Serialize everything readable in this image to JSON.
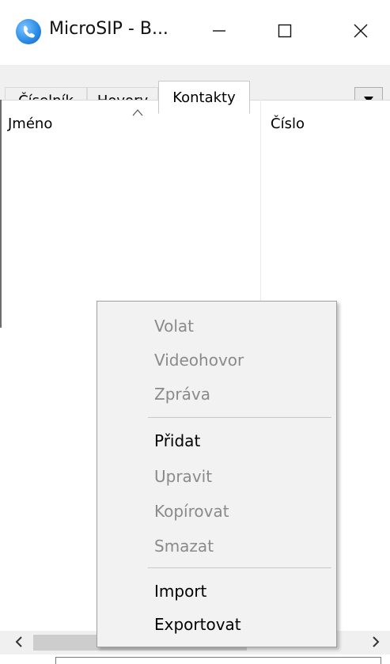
{
  "window": {
    "title": "MicroSIP - B...",
    "icon": "microsip-logo-icon",
    "controls": {
      "minimize": "minimize-icon",
      "maximize": "maximize-icon",
      "close": "close-icon"
    }
  },
  "tabs": [
    {
      "label": "Číselník",
      "active": false
    },
    {
      "label": "Hovory",
      "active": false
    },
    {
      "label": "Kontakty",
      "active": true
    }
  ],
  "tab_dropdown_icon": "triangle-down-icon",
  "list": {
    "columns": [
      {
        "label": "Jméno",
        "sorted": "ascending"
      },
      {
        "label": "Číslo"
      }
    ],
    "rows": []
  },
  "scrollbar": {
    "left_icon": "chevron-left-icon",
    "right_icon": "chevron-right-icon"
  },
  "context_menu": {
    "groups": [
      [
        {
          "label": "Volat",
          "enabled": false
        },
        {
          "label": "Videohovor",
          "enabled": false
        },
        {
          "label": "Zpráva",
          "enabled": false
        }
      ],
      [
        {
          "label": "Přidat",
          "enabled": true
        },
        {
          "label": "Upravit",
          "enabled": false
        },
        {
          "label": "Kopírovat",
          "enabled": false
        },
        {
          "label": "Smazat",
          "enabled": false
        }
      ],
      [
        {
          "label": "Import",
          "enabled": true
        },
        {
          "label": "Exportovat",
          "enabled": true
        }
      ]
    ]
  },
  "colors": {
    "disabled_text": "#8a8a8a",
    "menu_background": "#f2f2f2",
    "tab_background": "#f0f0f0",
    "icon_blue": "#2d8ee8"
  }
}
